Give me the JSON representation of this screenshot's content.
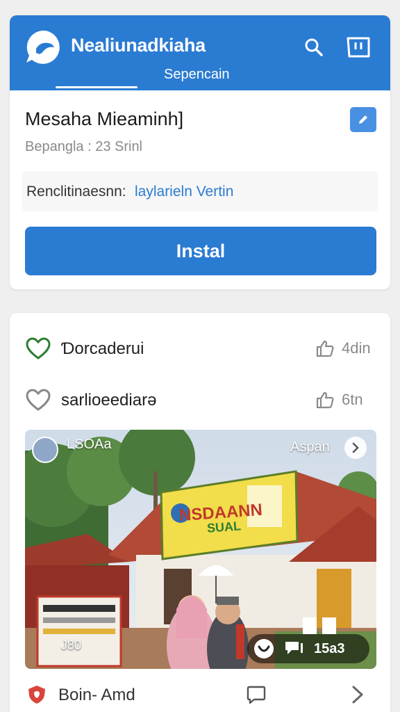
{
  "header": {
    "app_name": "Nealiunadkiaha",
    "subtab": "Sepencain",
    "color": "#2a7bd2"
  },
  "app_info": {
    "title": "Mesaha Mieaminh]",
    "meta": "Bepangla : 23 Srinl",
    "recommendation_label": "Renclitinaesnn:",
    "recommendation_link": "laylarieln Vertin",
    "install_label": "Instal"
  },
  "feed": {
    "items": [
      {
        "label": "Ɗorcaderui",
        "time": "4din",
        "heart_color": "#2e7d32"
      },
      {
        "label": "sarlioeediarə",
        "time": "6tn",
        "heart_color": "#888888"
      }
    ],
    "post": {
      "user": "LSOAa",
      "aspan": "Aspan",
      "banner_line1": "NSDAANN",
      "banner_line2": "SUAL",
      "sign_count": "J80",
      "stat_count": "15а3"
    },
    "bottom_bar": {
      "label": "Boin‐ Amd"
    }
  },
  "icons": {
    "logo": "chat-bubble-logo-icon",
    "search": "search-icon",
    "store": "shopping-bag-icon",
    "edit": "pencil-icon",
    "heart": "heart-outline-icon",
    "thumb": "thumbs-up-icon",
    "next": "chevron-right-icon",
    "like": "like-bubble-icon",
    "comment": "comment-icon",
    "shield": "shield-icon",
    "chat": "chat-icon",
    "chevron": "chevron-right-icon"
  }
}
